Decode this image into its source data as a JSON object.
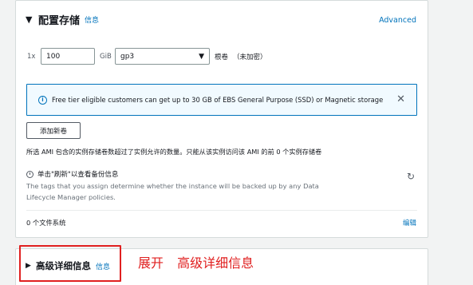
{
  "storage": {
    "title": "配置存储",
    "info_link": "信息",
    "advanced_link": "Advanced",
    "volume": {
      "multiplier": "1x",
      "size_value": "100",
      "size_unit": "GiB",
      "volume_type": "gp3",
      "root_label": "根卷",
      "encryption_label": "（未加密）"
    },
    "alert": {
      "icon": "info-icon",
      "text": "Free tier eligible customers can get up to 30 GB of EBS General Purpose (SSD) or Magnetic storage"
    },
    "add_volume_button": "添加新卷",
    "ami_note": "所选 AMI 包含的实例存储卷数超过了实例允许的数量。只能从该实例访问该 AMI 的前 0 个实例存储卷",
    "backup": {
      "title": "单击\"刷新\"以查看备份信息",
      "description": "The tags that you assign determine whether the instance will be backed up by any Data Lifecycle Manager policies."
    },
    "file_systems": "0 个文件系统",
    "edit_link": "编辑"
  },
  "advanced": {
    "title": "高级详细信息",
    "info_link": "信息"
  },
  "annotation": {
    "word1": "展开",
    "word2": "高级详细信息",
    "color": "#e02020"
  },
  "colors": {
    "link": "#0073bb",
    "alert_border": "#0073bb",
    "alert_bg": "#f1faff"
  }
}
